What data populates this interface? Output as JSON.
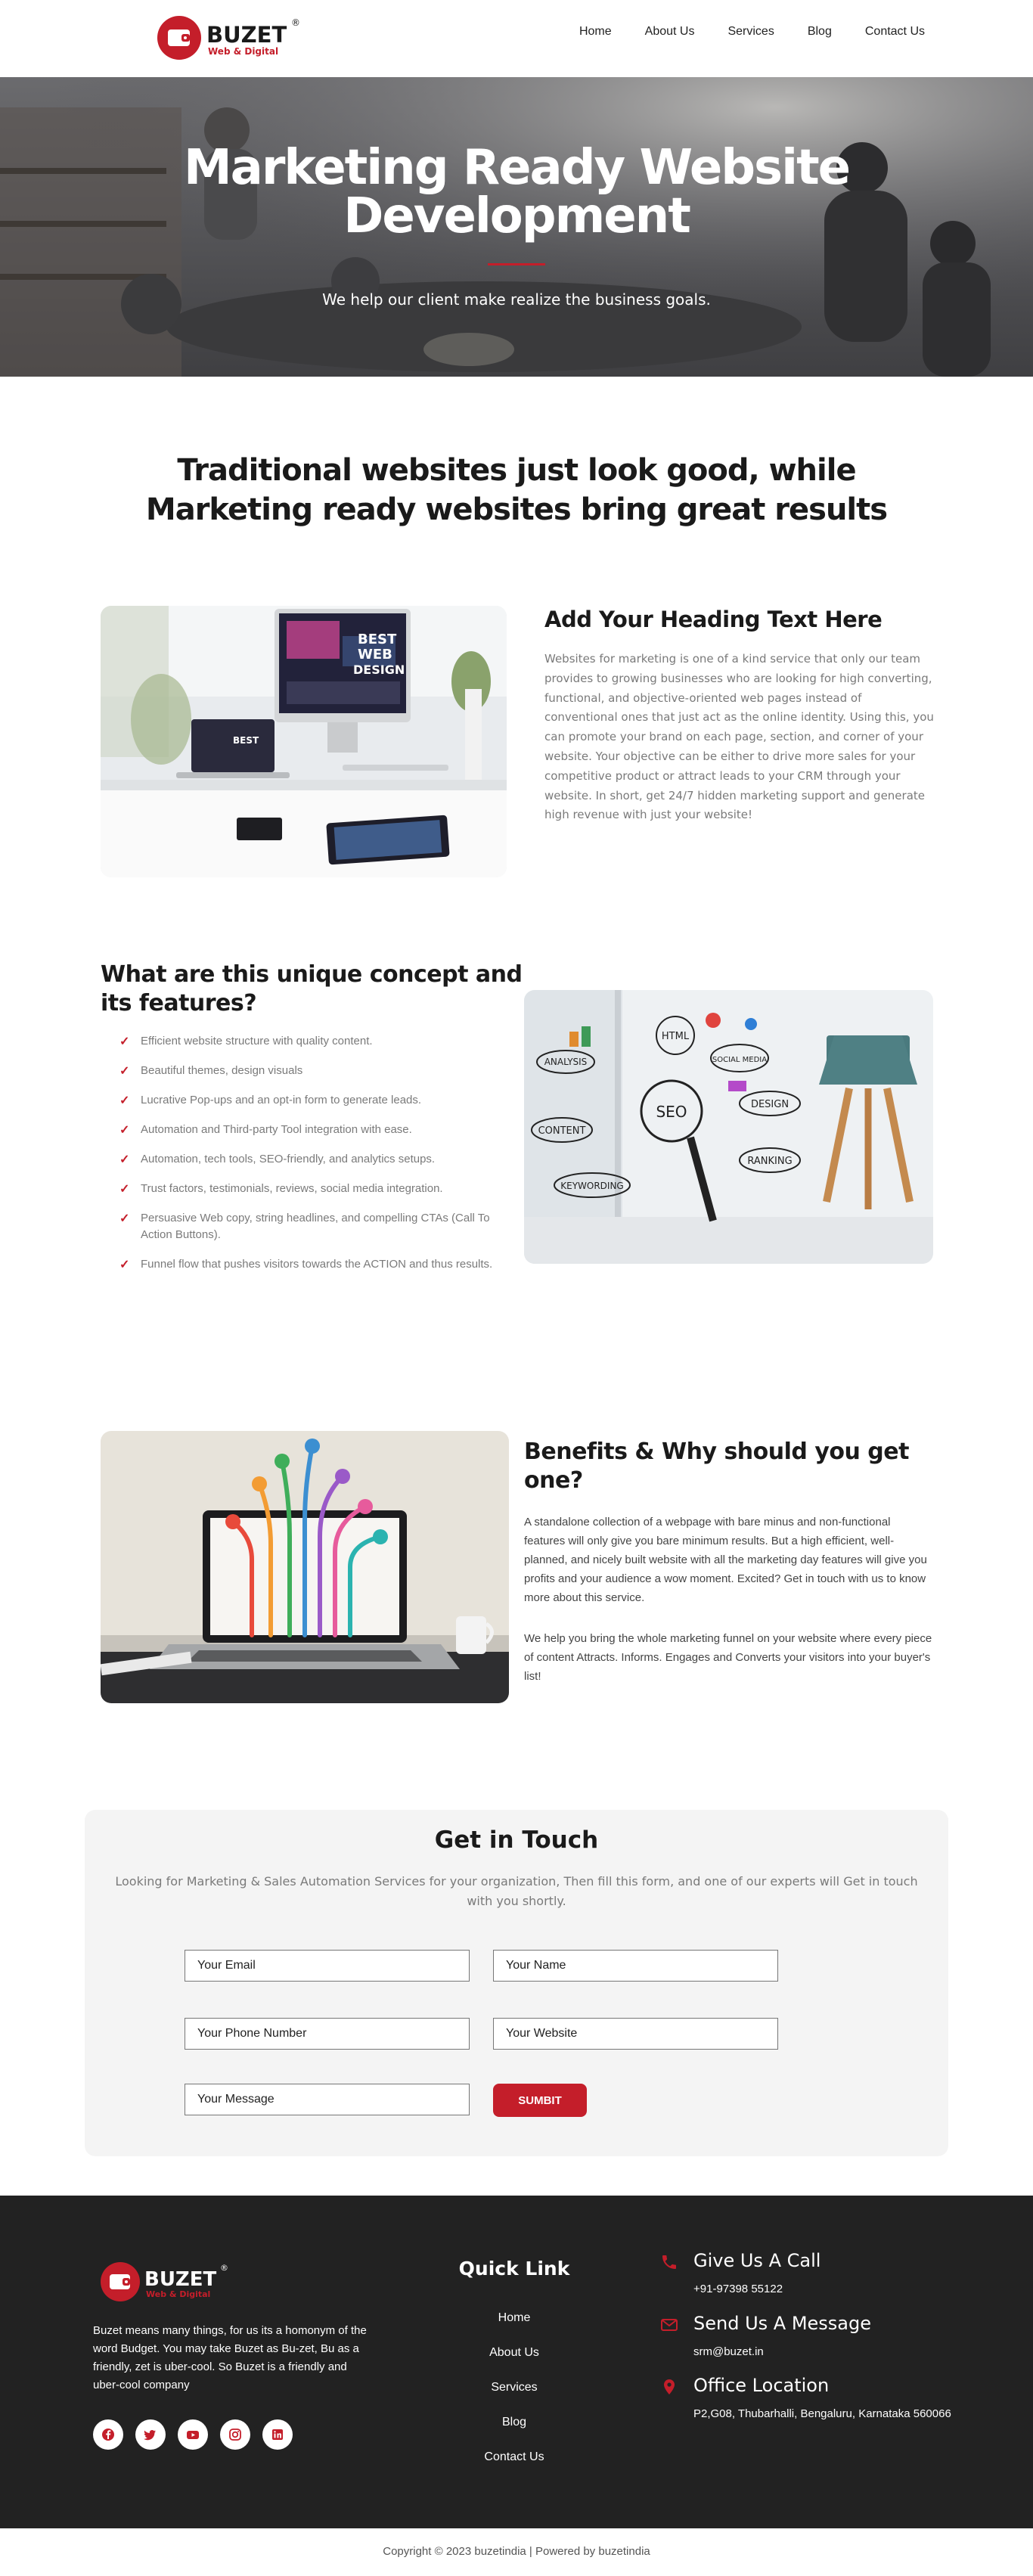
{
  "header": {
    "brand_name": "BUZET",
    "brand_tagline": "Web & Digital",
    "brand_mark": "®",
    "nav": [
      {
        "label": "Home"
      },
      {
        "label": "About Us"
      },
      {
        "label": "Services"
      },
      {
        "label": "Blog"
      },
      {
        "label": "Contact Us"
      }
    ]
  },
  "hero": {
    "title_line1": "Marketing Ready Website",
    "title_line2": "Development",
    "subtitle": "We help our client make realize the business goals."
  },
  "section1": {
    "title": "Traditional websites just look good, while Marketing ready websites bring great results",
    "image_text": [
      "BEST",
      "WEB",
      "DESIGN"
    ],
    "heading": "Add Your Heading Text Here",
    "body": "Websites for marketing is one of a kind service that only our team provides to growing businesses who are looking for high converting, functional, and objective-oriented web pages instead of conventional ones that just act as the online identity. Using this, you can promote your brand on each page, section, and corner of your website. Your objective can be either to drive more sales for your competitive product or attract leads to your CRM through your website. In short, get 24/7 hidden marketing support and generate high revenue with just your website!"
  },
  "features": {
    "heading": "What are this unique concept and its features?",
    "items": [
      {
        "text": "Efficient website structure with quality content."
      },
      {
        "text": "Beautiful themes, design visuals"
      },
      {
        "text": "Lucrative Pop-ups and an opt-in form to generate leads."
      },
      {
        "text": "Automation and Third-party Tool integration with ease."
      },
      {
        "text": "Automation, tech tools, SEO-friendly, and analytics setups."
      },
      {
        "text": "Trust factors, testimonials, reviews, social media integration."
      },
      {
        "text": "Persuasive Web copy, string headlines, and compelling CTAs (Call To Action Buttons)."
      },
      {
        "text": "Funnel flow that pushes visitors towards the ACTION and thus results."
      }
    ],
    "image_labels": [
      "ANALYSIS",
      "HTML",
      "SOCIAL MEDIA",
      "CONTENT",
      "SEO",
      "DESIGN",
      "RANKING",
      "KEYWORDING"
    ]
  },
  "benefits": {
    "heading": "Benefits & Why should you get one?",
    "body1": "A standalone collection of a webpage with bare minus and non-functional features will only give you bare minimum results. But a high efficient, well-planned, and nicely built website with all the marketing day features will give you profits and your audience a wow moment. Excited? Get in touch with us to know more about this service.",
    "body2": "We help you bring the whole marketing funnel on your website where every piece of content Attracts. Informs. Engages and Converts your visitors into your buyer's list!"
  },
  "contact": {
    "title": "Get in Touch",
    "subtitle": "Looking for Marketing & Sales Automation Services for your organization, Then fill this form, and one of our experts will Get in touch with you shortly.",
    "email_placeholder": "Your Email",
    "name_placeholder": "Your Name",
    "phone_placeholder": "Your Phone Number",
    "website_placeholder": "Your Website",
    "message_placeholder": "Your Message",
    "submit_label": "SUMBIT"
  },
  "footer": {
    "about": "Buzet means many things, for us its a homonym of the word Budget. You may take Buzet as Bu-zet, Bu as a friendly, zet is uber-cool. So Buzet is a friendly and uber-cool company",
    "socials": [
      {
        "icon": "facebook-icon"
      },
      {
        "icon": "twitter-icon"
      },
      {
        "icon": "youtube-icon"
      },
      {
        "icon": "instagram-icon"
      },
      {
        "icon": "linkedin-icon"
      }
    ],
    "quick_link_title": "Quick Link",
    "quick_links": [
      {
        "label": "Home"
      },
      {
        "label": "About Us"
      },
      {
        "label": "Services"
      },
      {
        "label": "Blog"
      },
      {
        "label": "Contact Us"
      }
    ],
    "call_title": "Give Us A Call",
    "call_value": "+91-97398 55122",
    "message_title": "Send Us A Message",
    "message_value": "srm@buzet.in",
    "location_title": "Office Location",
    "location_value": "P2,G08, Thubarhalli, Bengaluru, Karnataka 560066",
    "accent_color": "#c41e2a"
  },
  "copyright": "Copyright © 2023 buzetindia | Powered by buzetindia"
}
